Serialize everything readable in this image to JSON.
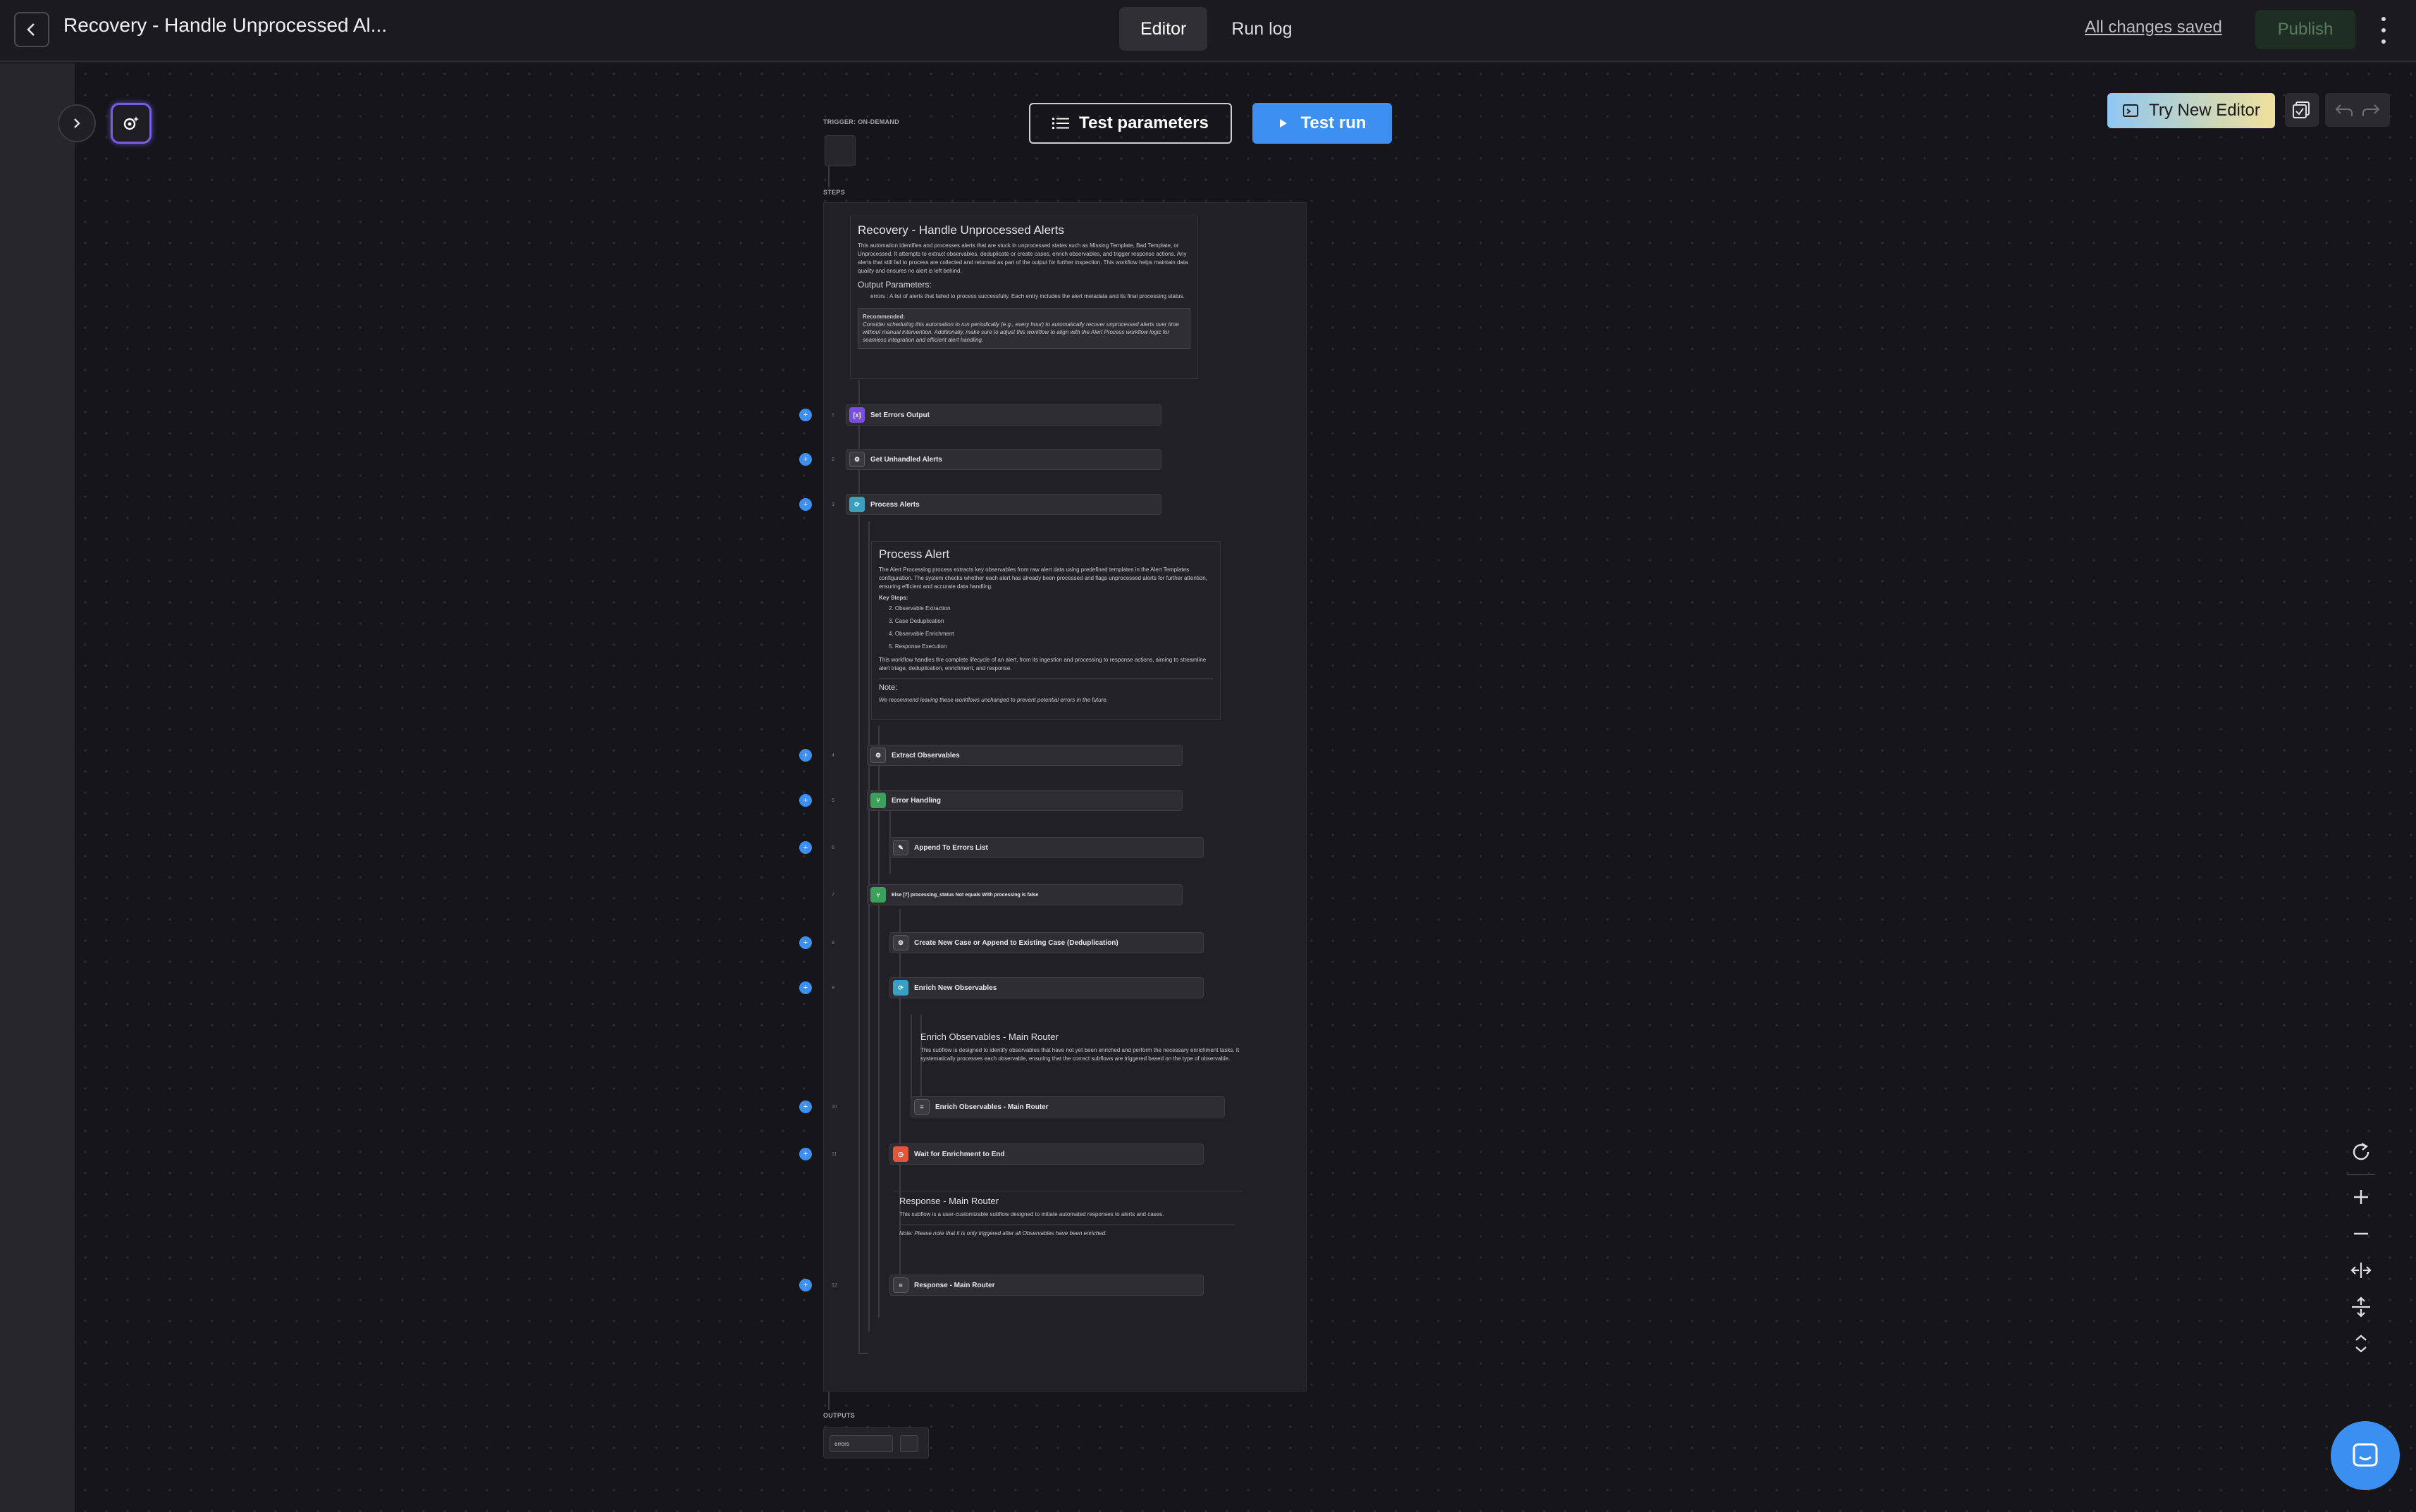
{
  "header": {
    "title": "Recovery - Handle Unprocessed Al...",
    "tabs": [
      {
        "label": "Editor",
        "active": true
      },
      {
        "label": "Run log",
        "active": false
      }
    ],
    "save_status": "All changes saved",
    "publish_label": "Publish"
  },
  "toolbar": {
    "test_parameters_label": "Test parameters",
    "test_run_label": "Test run",
    "try_new_editor_label": "Try New Editor"
  },
  "workflow": {
    "trigger_label": "TRIGGER: ON-DEMAND",
    "steps_label": "STEPS",
    "outputs_label": "OUTPUTS",
    "output_field": "errors",
    "intro_card": {
      "title": "Recovery - Handle Unprocessed Alerts",
      "body": "This automation identifies and processes alerts that are stuck in unprocessed states such as Missing Template, Bad Template, or Unprocessed. It attempts to extract observables, deduplicate or create cases, enrich observables, and trigger response actions. Any alerts that still fail to process are collected and returned as part of the output for further inspection. This workflow helps maintain data quality and ensures no alert is left behind.",
      "output_params_heading": "Output Parameters:",
      "output_param": "errors : A list of alerts that failed to process successfully. Each entry includes the alert metadata and its final processing status.",
      "recommend_title": "Recommended:",
      "recommend_body": "Consider scheduling this automation to run periodically (e.g., every hour) to automatically recover unprocessed alerts over time without manual intervention. Additionally, make sure to adjust this workflow to align with the Alert Process workflow logic for seamless integration and efficient alert handling."
    },
    "process_card": {
      "title": "Process Alert",
      "body": "The Alert Processing process extracts key observables from raw alert data using predefined templates in the Alert Templates configuration. The system checks whether each alert has already been processed and flags unprocessed alerts for further attention, ensuring efficient and accurate data handling.",
      "key_steps_heading": "Key Steps:",
      "key_steps": [
        "2. Observable Extraction",
        "3. Case Deduplication",
        "4. Observable Enrichment",
        "5. Response Execution"
      ],
      "footer": "This workflow handles the complete lifecycle of an alert, from its ingestion and processing to response actions, aiming to streamline alert triage, deduplication, enrichment, and response.",
      "note_heading": "Note:",
      "note_body": "We recommend leaving these workflows unchanged to prevent potential errors in the future."
    },
    "enrich_card": {
      "title": "Enrich Observables - Main Router",
      "body": "This subflow is designed to identify observables that have not yet been enriched and perform the necessary enrichment tasks. It systematically processes each observable, ensuring that the correct subflows are triggered based on the type of observable."
    },
    "response_card": {
      "title": "Response - Main Router",
      "body": "This subflow is a user-customizable subflow designed to initiate automated responses to alerts and cases.",
      "note": "Note: Please note that it is only triggered after all Observables have been enriched."
    },
    "steps": [
      {
        "label": "Set Errors Output",
        "num": "1",
        "icon": "[x]",
        "color": "#7a4fe0"
      },
      {
        "label": "Get Unhandled Alerts",
        "num": "2",
        "icon": "⚙",
        "color": "#3a3a40"
      },
      {
        "label": "Process Alerts",
        "num": "3",
        "icon": "⟳",
        "color": "#3a9fc0"
      },
      {
        "label": "Extract Observables",
        "num": "4",
        "icon": "⚙",
        "color": "#3a3a40"
      },
      {
        "label": "Error Handling",
        "num": "5",
        "icon": "⑂",
        "color": "#3aa05a"
      },
      {
        "label": "Append To Errors List",
        "num": "6",
        "icon": "✎",
        "color": "#3a3a40"
      },
      {
        "label": "Else  [7] processing_status  Not equals  With processing  is false",
        "num": "7",
        "icon": "⑂",
        "color": "#3aa05a"
      },
      {
        "label": "Create New Case or Append to Existing Case (Deduplication)",
        "num": "8",
        "icon": "⚙",
        "color": "#3a3a40"
      },
      {
        "label": "Enrich New Observables",
        "num": "9",
        "icon": "⟳",
        "color": "#3a9fc0"
      },
      {
        "label": "Enrich Observables - Main Router",
        "num": "10",
        "icon": "≡",
        "color": "#3a3a40"
      },
      {
        "label": "Wait for Enrichment to End",
        "num": "11",
        "icon": "◷",
        "color": "#e0573a"
      },
      {
        "label": "Response - Main Router",
        "num": "12",
        "icon": "≡",
        "color": "#3a3a40"
      }
    ]
  },
  "zoom_controls": [
    "reset-icon",
    "zoom-in-icon",
    "zoom-out-icon",
    "fit-width-icon",
    "fit-height-icon",
    "collapse-icon"
  ],
  "colors": {
    "accent": "#3d8ff0",
    "background": "#15151a",
    "publish_disabled": "#1f2e22"
  }
}
